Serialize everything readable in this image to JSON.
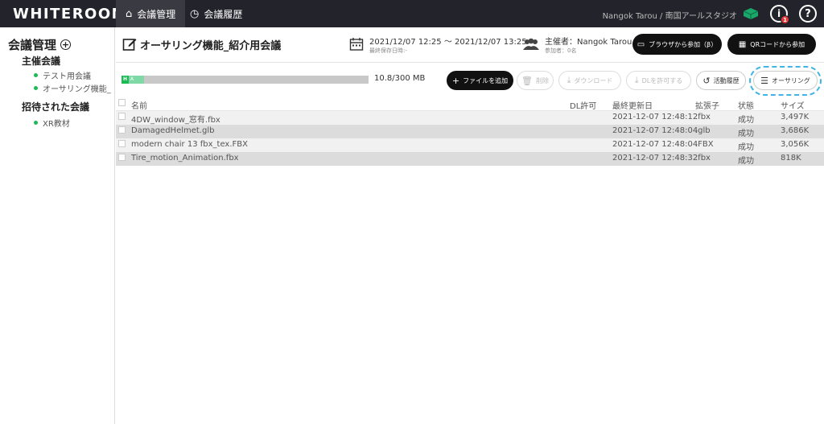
{
  "topbar": {
    "logo": "WHITEROOM",
    "tabs": [
      {
        "label": "会議管理",
        "icon": "home-icon"
      },
      {
        "label": "会議履歴",
        "icon": "history-icon"
      }
    ],
    "user_label": "Nangok Tarou / 南国アールスタジオ",
    "notification_count": "1",
    "info_symbol": "i",
    "help_symbol": "?"
  },
  "sidebar": {
    "title": "会議管理",
    "add_symbol": "+",
    "hosted_section": "主催会議",
    "hosted_items": [
      "テスト用会議",
      "オーサリング機能_紹介用会議"
    ],
    "invited_section": "招待された会議",
    "invited_items": [
      "XR教材"
    ]
  },
  "header": {
    "title": "オーサリング機能_紹介用会議",
    "date_range": "2021/12/07 12:25 ～ 2021/12/07 13:25",
    "last_saved": "最終保存日時:-",
    "host": "主催者：Nangok Tarou",
    "participants": "参加者：0名",
    "browser_join": "ブラウザから参加（β）",
    "qr_join": "QRコードから参加"
  },
  "toolbar": {
    "storage_h": "H",
    "storage_a": "A",
    "storage_used_fraction": 0.036,
    "storage_text": "10.8/300 MB",
    "add_file": "ファイルを追加",
    "delete": "削除",
    "download": "ダウンロード",
    "allow_dl": "DLを許可する",
    "activity_history": "活動履歴",
    "authoring": "オーサリング"
  },
  "table": {
    "headers": {
      "name": "名前",
      "dl": "DL許可",
      "updated": "最終更新日",
      "ext": "拡張子",
      "status": "状態",
      "size": "サイズ"
    },
    "rows": [
      {
        "name": "4DW_window_窓有.fbx",
        "dl": "",
        "updated": "2021-12-07 12:48:12",
        "ext": ".fbx",
        "status": "成功",
        "size": "3,497K"
      },
      {
        "name": "DamagedHelmet.glb",
        "dl": "",
        "updated": "2021-12-07 12:48:04",
        "ext": ".glb",
        "status": "成功",
        "size": "3,686K"
      },
      {
        "name": "modern chair 13 fbx_tex.FBX",
        "dl": "",
        "updated": "2021-12-07 12:48:04",
        "ext": ".FBX",
        "status": "成功",
        "size": "3,056K"
      },
      {
        "name": "Tire_motion_Animation.fbx",
        "dl": "",
        "updated": "2021-12-07 12:48:32",
        "ext": ".fbx",
        "status": "成功",
        "size": "818K"
      }
    ]
  },
  "colors": {
    "accent": "#1db954",
    "topbar": "#23232b",
    "highlight": "#3fb4e5"
  }
}
